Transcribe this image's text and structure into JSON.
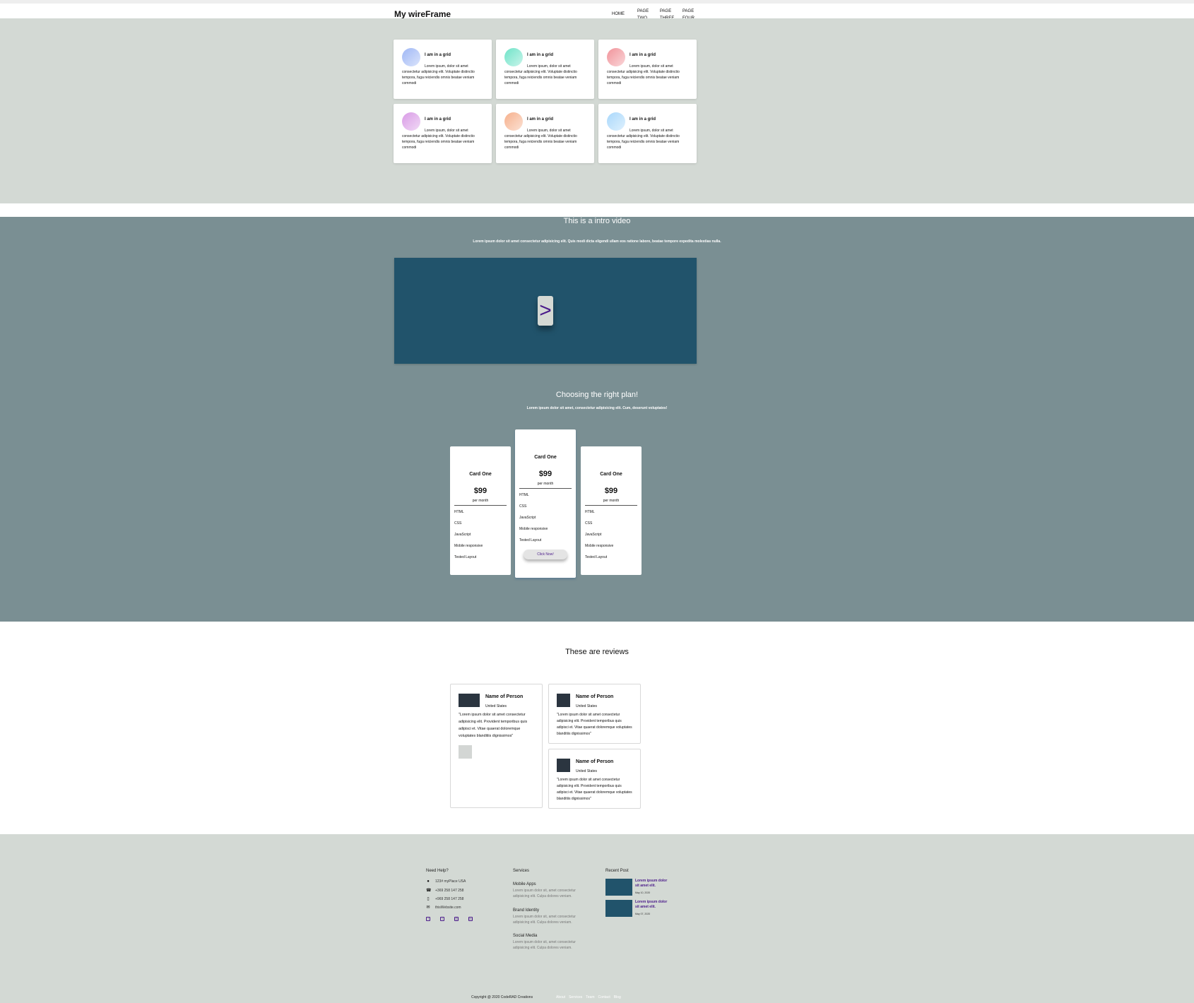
{
  "header": {
    "brand": "My wireFrame",
    "nav": [
      "HOME",
      "PAGE TWO",
      "PAGE THREE",
      "PAGE FOUR"
    ]
  },
  "grid": {
    "cards": [
      {
        "title": "I am in a grid",
        "text": "Lorem ipsum, dolor sit amet consectetur adipisicing elit. Voluptate distinctio tempora, fuga reiciendis omnis beatae veniam commodi",
        "color": "#9fb7f5"
      },
      {
        "title": "I am in a grid",
        "text": "Lorem ipsum, dolor sit amet consectetur adipisicing elit. Voluptate distinctio tempora, fuga reiciendis omnis beatae veniam commodi",
        "color": "#6fe3c8"
      },
      {
        "title": "I am in a grid",
        "text": "Lorem ipsum, dolor sit amet consectetur adipisicing elit. Voluptate distinctio tempora, fuga reiciendis omnis beatae veniam commodi",
        "color": "#f1939a"
      },
      {
        "title": "I am in a grid",
        "text": "Lorem ipsum, dolor sit amet consectetur adipisicing elit. Voluptate distinctio tempora, fuga reiciendis omnis beatae veniam commodi",
        "color": "#d99be6"
      },
      {
        "title": "I am in a grid",
        "text": "Lorem ipsum, dolor sit amet consectetur adipisicing elit. Voluptate distinctio tempora, fuga reiciendis omnis beatae veniam commodi",
        "color": "#f6b08c"
      },
      {
        "title": "I am in a grid",
        "text": "Lorem ipsum, dolor sit amet consectetur adipisicing elit. Voluptate distinctio tempora, fuga reiciendis omnis beatae veniam commodi",
        "color": "#a9d8fb"
      }
    ]
  },
  "video": {
    "title": "This is a intro video",
    "subtitle": "Lorem ipsum dolor sit amet consectetur adipisicing elit. Quis modi dicta eligendi ullam eos ratione labore, beatae tempore expedita molestias nulla.",
    "play_symbol": ">"
  },
  "plans": {
    "title": "Choosing the right plan!",
    "subtitle": "Lorem ipsum dolor sit amet, consectetur adipisicing elit. Cum, deserunt voluptates!",
    "cards": [
      {
        "name": "Card One",
        "price": "$99",
        "period": "per month",
        "features": [
          "HTML",
          "CSS",
          "JavaScript",
          "Mobile responsive",
          "Tested Layout"
        ]
      },
      {
        "name": "Card One",
        "price": "$99",
        "period": "per month",
        "features": [
          "HTML",
          "CSS",
          "JavaScript",
          "Mobile responsive",
          "Tested Layout"
        ],
        "button": "Click Now!"
      },
      {
        "name": "Card One",
        "price": "$99",
        "period": "per month",
        "features": [
          "HTML",
          "CSS",
          "JavaScript",
          "Mobile responsive",
          "Tested Layout"
        ]
      }
    ]
  },
  "reviews": {
    "title": "These are reviews",
    "items": [
      {
        "name": "Name of Person",
        "location": "United States",
        "text": "\"Lorem ipsum dolor sit amet consectetur adipisicing elit. Provident temporibus quis adipisci et. Vitae quaerat doloremque voluptates blanditiis dignissimos\""
      },
      {
        "name": "Name of Person",
        "location": "United States",
        "text": "\"Lorem ipsum dolor sit amet consectetur adipisicing elit. Provident temporibus quis adipisci et. Vitae quaerat doloremque voluptates blanditiis dignissimos\""
      },
      {
        "name": "Name of Person",
        "location": "United States",
        "text": "\"Lorem ipsum dolor sit amet consectetur adipisicing elit. Provident temporibus quis adipisci et. Vitae quaerat doloremque voluptates blanditiis dignissimos\""
      }
    ]
  },
  "footer": {
    "help": {
      "title": "Need Help?",
      "address": "123# myPlace USA",
      "phone": "+369 258 147 258",
      "mobile": "+969 258 147 258",
      "email": "thisWebsite.com"
    },
    "services": {
      "title": "Services",
      "items": [
        {
          "name": "Mobile Apps",
          "text": "Lorem ipsum dolor sit, amet consectetur adipisicing elit. Culpa dolores veniam."
        },
        {
          "name": "Brand Identity",
          "text": "Lorem ipsum dolor sit, amet consectetur adipisicing elit. Culpa dolores veniam."
        },
        {
          "name": "Social Media",
          "text": "Lorem ipsum dolor sit, amet consectetur adipisicing elit. Culpa dolores veniam."
        }
      ]
    },
    "recent": {
      "title": "Recent Post",
      "posts": [
        {
          "title": "Lorem ipsum dolor sit amet elit.",
          "date": "May 10, 2020"
        },
        {
          "title": "Lorem ipsum dolor sit amet elit.",
          "date": "May 07, 2020"
        }
      ]
    },
    "copyright": "Copyright @ 2020 CodeRAD Creations",
    "links": [
      "About",
      "Services",
      "Team",
      "Contact",
      "Blog"
    ]
  }
}
